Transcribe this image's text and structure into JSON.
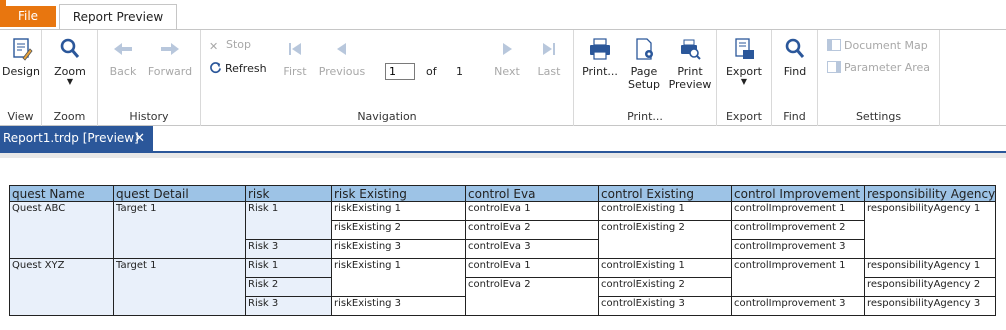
{
  "tabs": {
    "file": "File",
    "report_preview": "Report Preview"
  },
  "ribbon": {
    "view": {
      "design": "Design",
      "label": "View"
    },
    "zoom": {
      "zoom": "Zoom",
      "label": "Zoom"
    },
    "history": {
      "back": "Back",
      "forward": "Forward",
      "label": "History"
    },
    "navigation": {
      "stop": "Stop",
      "refresh": "Refresh",
      "first": "First",
      "previous": "Previous",
      "page_value": "1",
      "of": "of",
      "total_pages": "1",
      "next": "Next",
      "last": "Last",
      "label": "Navigation"
    },
    "print": {
      "print": "Print...",
      "page_setup_1": "Page",
      "page_setup_2": "Setup",
      "print_preview_1": "Print",
      "print_preview_2": "Preview",
      "label": "Print..."
    },
    "export": {
      "export": "Export",
      "label": "Export"
    },
    "find": {
      "find": "Find",
      "label": "Find"
    },
    "settings": {
      "document_map": "Document Map",
      "parameter_area": "Parameter Area",
      "label": "Settings"
    }
  },
  "doc_tab": {
    "title": "Report1.trdp [Preview]",
    "close": "✕"
  },
  "colors": {
    "accent": "#2b579a",
    "file_tab": "#e8760f",
    "header_bg": "#9dc3e6",
    "shaded_cell": "#e9f0fa"
  },
  "report": {
    "headers": [
      "quest Name",
      "quest Detail",
      "risk",
      "risk Existing",
      "control Eva",
      "control Existing",
      "control Improvement",
      "responsibility Agency"
    ],
    "rows": [
      {
        "quest_name": "Quest ABC",
        "quest_detail": "Target 1",
        "risks": [
          "Risk 1",
          "Risk 3"
        ],
        "risk_existing": [
          "riskExisting 1",
          "riskExisting 2",
          "riskExisting 3"
        ],
        "control_eva": [
          "controlEva 1",
          "controlEva 2",
          "controlEva 3"
        ],
        "control_existing": [
          "controlExisting 1",
          "controlExisting 2"
        ],
        "control_improvement": [
          "controlImprovement 1",
          "controlImprovement 2",
          "controlImprovement 3"
        ],
        "responsibility": [
          "responsibilityAgency 1"
        ]
      },
      {
        "quest_name": "Quest XYZ",
        "quest_detail": "Target 1",
        "risks": [
          "Risk 1",
          "Risk 2",
          "Risk 3"
        ],
        "risk_existing": [
          "riskExisting 1",
          "riskExisting 3"
        ],
        "control_eva": [
          "controlEva 1",
          "controlEva 2"
        ],
        "control_existing": [
          "controlExisting 1",
          "controlExisting 2",
          "controlExisting 3"
        ],
        "control_improvement": [
          "controlImprovement 1",
          "controlImprovement 3"
        ],
        "responsibility": [
          "responsibilityAgency 1",
          "responsibilityAgency 2",
          "responsibilityAgency 3"
        ]
      }
    ]
  }
}
